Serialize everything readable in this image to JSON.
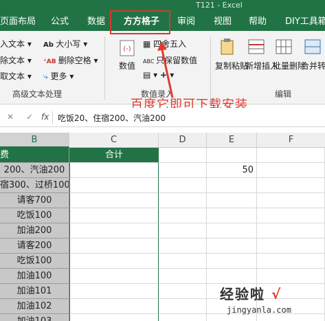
{
  "title_bar": {
    "text": "T121 - Excel"
  },
  "tabs": [
    {
      "label": "页面布局"
    },
    {
      "label": "公式"
    },
    {
      "label": "数据"
    },
    {
      "label": "方方格子"
    },
    {
      "label": "审阅"
    },
    {
      "label": "视图"
    },
    {
      "label": "帮助"
    },
    {
      "label": "DIY工具箱"
    }
  ],
  "ribbon": {
    "text_group": {
      "items": [
        "入文本 ▾",
        "除文本 ▾",
        "取文本 ▾"
      ],
      "case_label": "大小写 ▾",
      "remove_spaces_label": "删除空格 ▾",
      "more_label": "更多 ▾",
      "group_label": "高级文本处理"
    },
    "number_group": {
      "value_label": "数值",
      "round_label": "四舍五入",
      "keep_value_label": "只保留数值",
      "group_label": "数值录入"
    },
    "edit_group": {
      "copy_paste_label": "复制粘贴",
      "insert_label": "新增插入",
      "batch_delete_label": "批量删除",
      "merge_label": "合并转换",
      "group_label": "编辑"
    }
  },
  "annotation": "百度它即可下载安装",
  "formula_bar": {
    "cancel_icon": "✕",
    "confirm_icon": "✓",
    "fx_label": "fx",
    "content": "吃饭20、住宿200、汽油200"
  },
  "columns": [
    "B",
    "C",
    "D",
    "E",
    "F"
  ],
  "rows": {
    "b_values": [
      "费",
      "200、汽油200",
      "宿300、过桥100",
      "请客700",
      "吃饭100",
      "加油200",
      "请客200",
      "吃饭100",
      "加油100",
      "加油101",
      "加油102",
      "加油103"
    ],
    "c_header": "合计",
    "e_value": "50"
  },
  "watermark": {
    "main": "经验啦",
    "check": "√",
    "sub": "jingyanla.com"
  }
}
